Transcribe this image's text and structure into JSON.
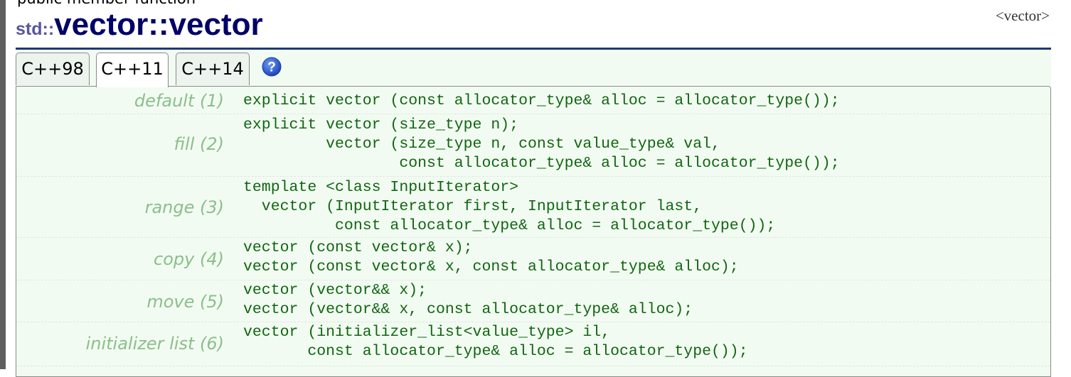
{
  "header": {
    "member_kind": "public member function",
    "title_namespace": "std::",
    "title_class": "vector",
    "title_separator": "::",
    "title_member": "vector",
    "header_link": "<vector>"
  },
  "tabs": [
    {
      "label": "C++98",
      "active": false
    },
    {
      "label": "C++11",
      "active": true
    },
    {
      "label": "C++14",
      "active": false
    }
  ],
  "help_icon": {
    "icon": "question-mark-circle-icon",
    "glyph": "?",
    "color": "#2a5bd7"
  },
  "colors": {
    "label": "#8bbf8b",
    "code": "#116611",
    "background": "#f2fbf2",
    "title": "#000066"
  },
  "overloads": [
    {
      "label": "default (1)",
      "code": "explicit vector (const allocator_type& alloc = allocator_type());"
    },
    {
      "label": "fill (2)",
      "code": "explicit vector (size_type n);\n         vector (size_type n, const value_type& val,\n                 const allocator_type& alloc = allocator_type());"
    },
    {
      "label": "range (3)",
      "code": "template <class InputIterator>\n  vector (InputIterator first, InputIterator last,\n          const allocator_type& alloc = allocator_type());"
    },
    {
      "label": "copy (4)",
      "code": "vector (const vector& x);\nvector (const vector& x, const allocator_type& alloc);"
    },
    {
      "label": "move (5)",
      "code": "vector (vector&& x);\nvector (vector&& x, const allocator_type& alloc);"
    },
    {
      "label": "initializer list (6)",
      "code": "vector (initializer_list<value_type> il,\n       const allocator_type& alloc = allocator_type());"
    }
  ]
}
